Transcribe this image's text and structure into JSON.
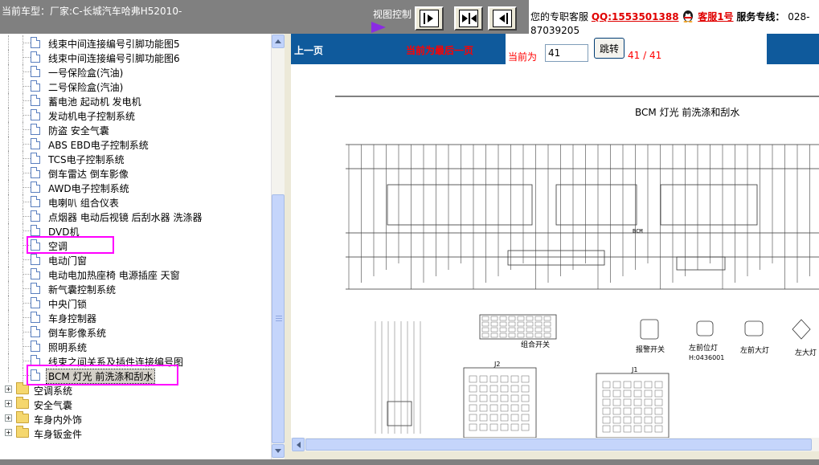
{
  "header": {
    "vehicle": "当前车型：厂家:C-长城汽车哈弗H52010-",
    "view_control": "视图控制",
    "support_prefix": "您的专职客服",
    "qq": "QQ:1553501388",
    "agent": "客服1号",
    "hotline_label": "服务专线：",
    "hotline_number_a": "028-",
    "hotline_number_b": "87039205"
  },
  "tree": {
    "items": [
      {
        "label": "线束中间连接编号引脚功能图5"
      },
      {
        "label": "线束中间连接编号引脚功能图6"
      },
      {
        "label": "一号保险盒(汽油)"
      },
      {
        "label": "二号保险盒(汽油)"
      },
      {
        "label": "蓄电池 起动机 发电机"
      },
      {
        "label": "发动机电子控制系统"
      },
      {
        "label": "防盗 安全气囊"
      },
      {
        "label": "ABS EBD电子控制系统"
      },
      {
        "label": "TCS电子控制系统"
      },
      {
        "label": "倒车雷达 倒车影像"
      },
      {
        "label": "AWD电子控制系统"
      },
      {
        "label": "电喇叭 组合仪表"
      },
      {
        "label": "点烟器 电动后视镜 后刮水器 洗涤器"
      },
      {
        "label": "DVD机"
      },
      {
        "label": "空调"
      },
      {
        "label": "电动门窗"
      },
      {
        "label": "电动电加热座椅 电源插座 天窗"
      },
      {
        "label": "新气囊控制系统"
      },
      {
        "label": "中央门锁"
      },
      {
        "label": "车身控制器"
      },
      {
        "label": "倒车影像系统"
      },
      {
        "label": "照明系统"
      },
      {
        "label": "线束之间关系及插件连接编号图"
      },
      {
        "label": "BCM 灯光 前洗涤和刮水"
      }
    ],
    "folders": [
      {
        "label": "空调系统"
      },
      {
        "label": "安全气囊"
      },
      {
        "label": "车身内外饰"
      },
      {
        "label": "车身钣金件"
      }
    ]
  },
  "viewer": {
    "prev": "上一页",
    "last_page_msg": "当前为最后一页",
    "current_label": "当前为",
    "page_value": "41",
    "goto": "跳转",
    "page_count": "41 / 41",
    "diagram": {
      "title": "BCM 灯光 前洗涤和刮水",
      "bcm_label": "BCM",
      "combo_switch": "组合开关",
      "alarm_switch": "报警开关",
      "left_front_pos": "左前位灯",
      "left_front_pos_code": "H:0436001",
      "left_front_big": "左前大灯",
      "left_big": "左大灯",
      "j2": "J2",
      "j1": "J1"
    }
  }
}
